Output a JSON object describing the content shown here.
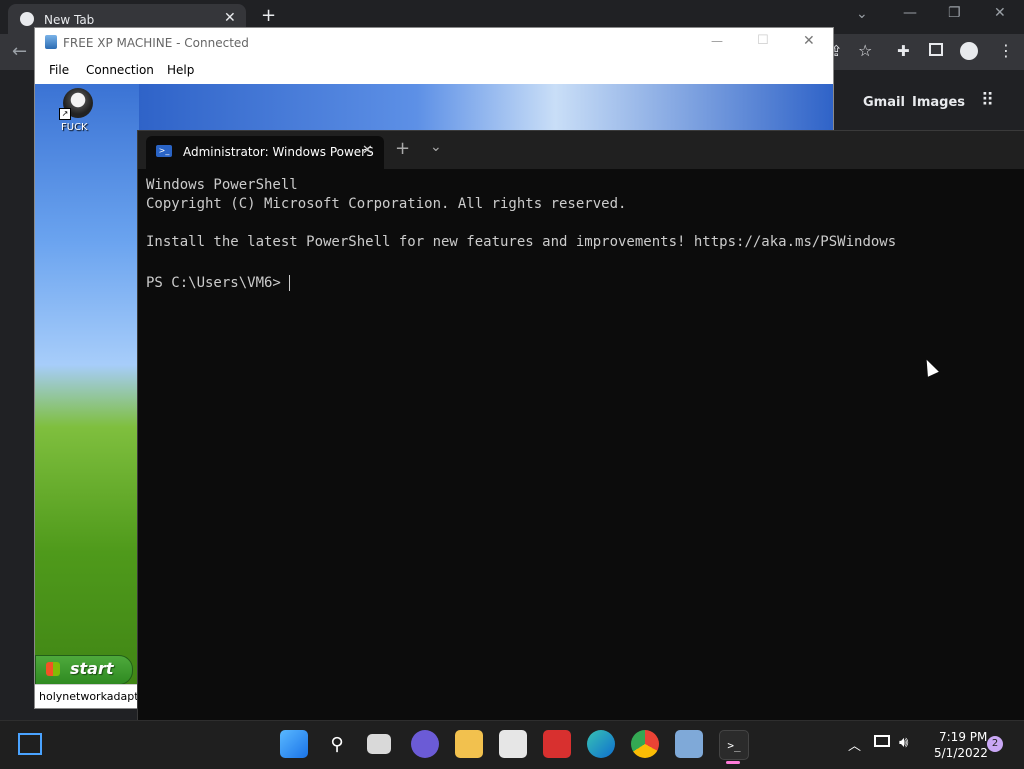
{
  "browser": {
    "tab_title": "New Tab",
    "links": {
      "gmail": "Gmail",
      "images": "Images"
    }
  },
  "rdp": {
    "title": "FREE XP MACHINE - Connected",
    "menu": [
      "File",
      "Connection",
      "Help"
    ],
    "desktop_icon_label": "FUCK",
    "start_label": "start",
    "taskbar_item": "holynetworkadapte"
  },
  "terminal": {
    "tab_title": "Administrator: Windows PowerS",
    "lines": [
      "Windows PowerShell",
      "Copyright (C) Microsoft Corporation. All rights reserved.",
      "",
      "Install the latest PowerShell for new features and improvements! https://aka.ms/PSWindows",
      "",
      "PS C:\\Users\\VM6> "
    ]
  },
  "taskbar": {
    "time": "7:19 PM",
    "date": "5/1/2022",
    "notification_count": "2"
  }
}
